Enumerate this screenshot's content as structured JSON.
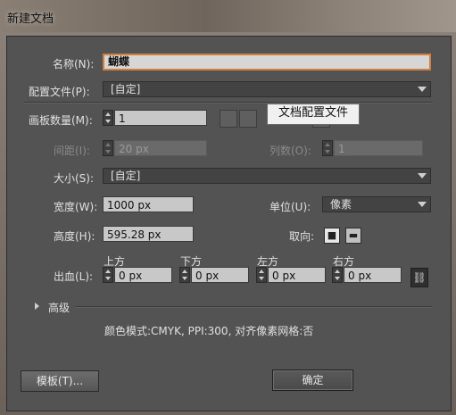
{
  "window": {
    "title": "新建文档"
  },
  "name": {
    "label": "名称(N):",
    "value": "蝴蝶"
  },
  "profile": {
    "label": "配置文件(P):",
    "value": "[自定]"
  },
  "artboards": {
    "label": "画板数量(M):",
    "value": "1",
    "tooltip": "文档配置文件"
  },
  "spacing": {
    "label": "间距(I):",
    "value": "20 px"
  },
  "columns": {
    "label": "列数(O):",
    "value": "1"
  },
  "size": {
    "label": "大小(S):",
    "value": "[自定]"
  },
  "width": {
    "label": "宽度(W):",
    "value": "1000 px"
  },
  "units": {
    "label": "单位(U):",
    "value": "像素"
  },
  "height": {
    "label": "高度(H):",
    "value": "595.28 px"
  },
  "orientation": {
    "label": "取向:"
  },
  "bleed": {
    "label": "出血(L):",
    "top": {
      "label": "上方",
      "value": "0 px"
    },
    "bottom": {
      "label": "下方",
      "value": "0 px"
    },
    "left": {
      "label": "左方",
      "value": "0 px"
    },
    "right": {
      "label": "右方",
      "value": "0 px"
    }
  },
  "advanced": {
    "label": "高级"
  },
  "summary": {
    "text": "颜色模式:CMYK, PPI:300, 对齐像素网格:否"
  },
  "buttons": {
    "templates": "模板(T)...",
    "ok": "确定"
  }
}
